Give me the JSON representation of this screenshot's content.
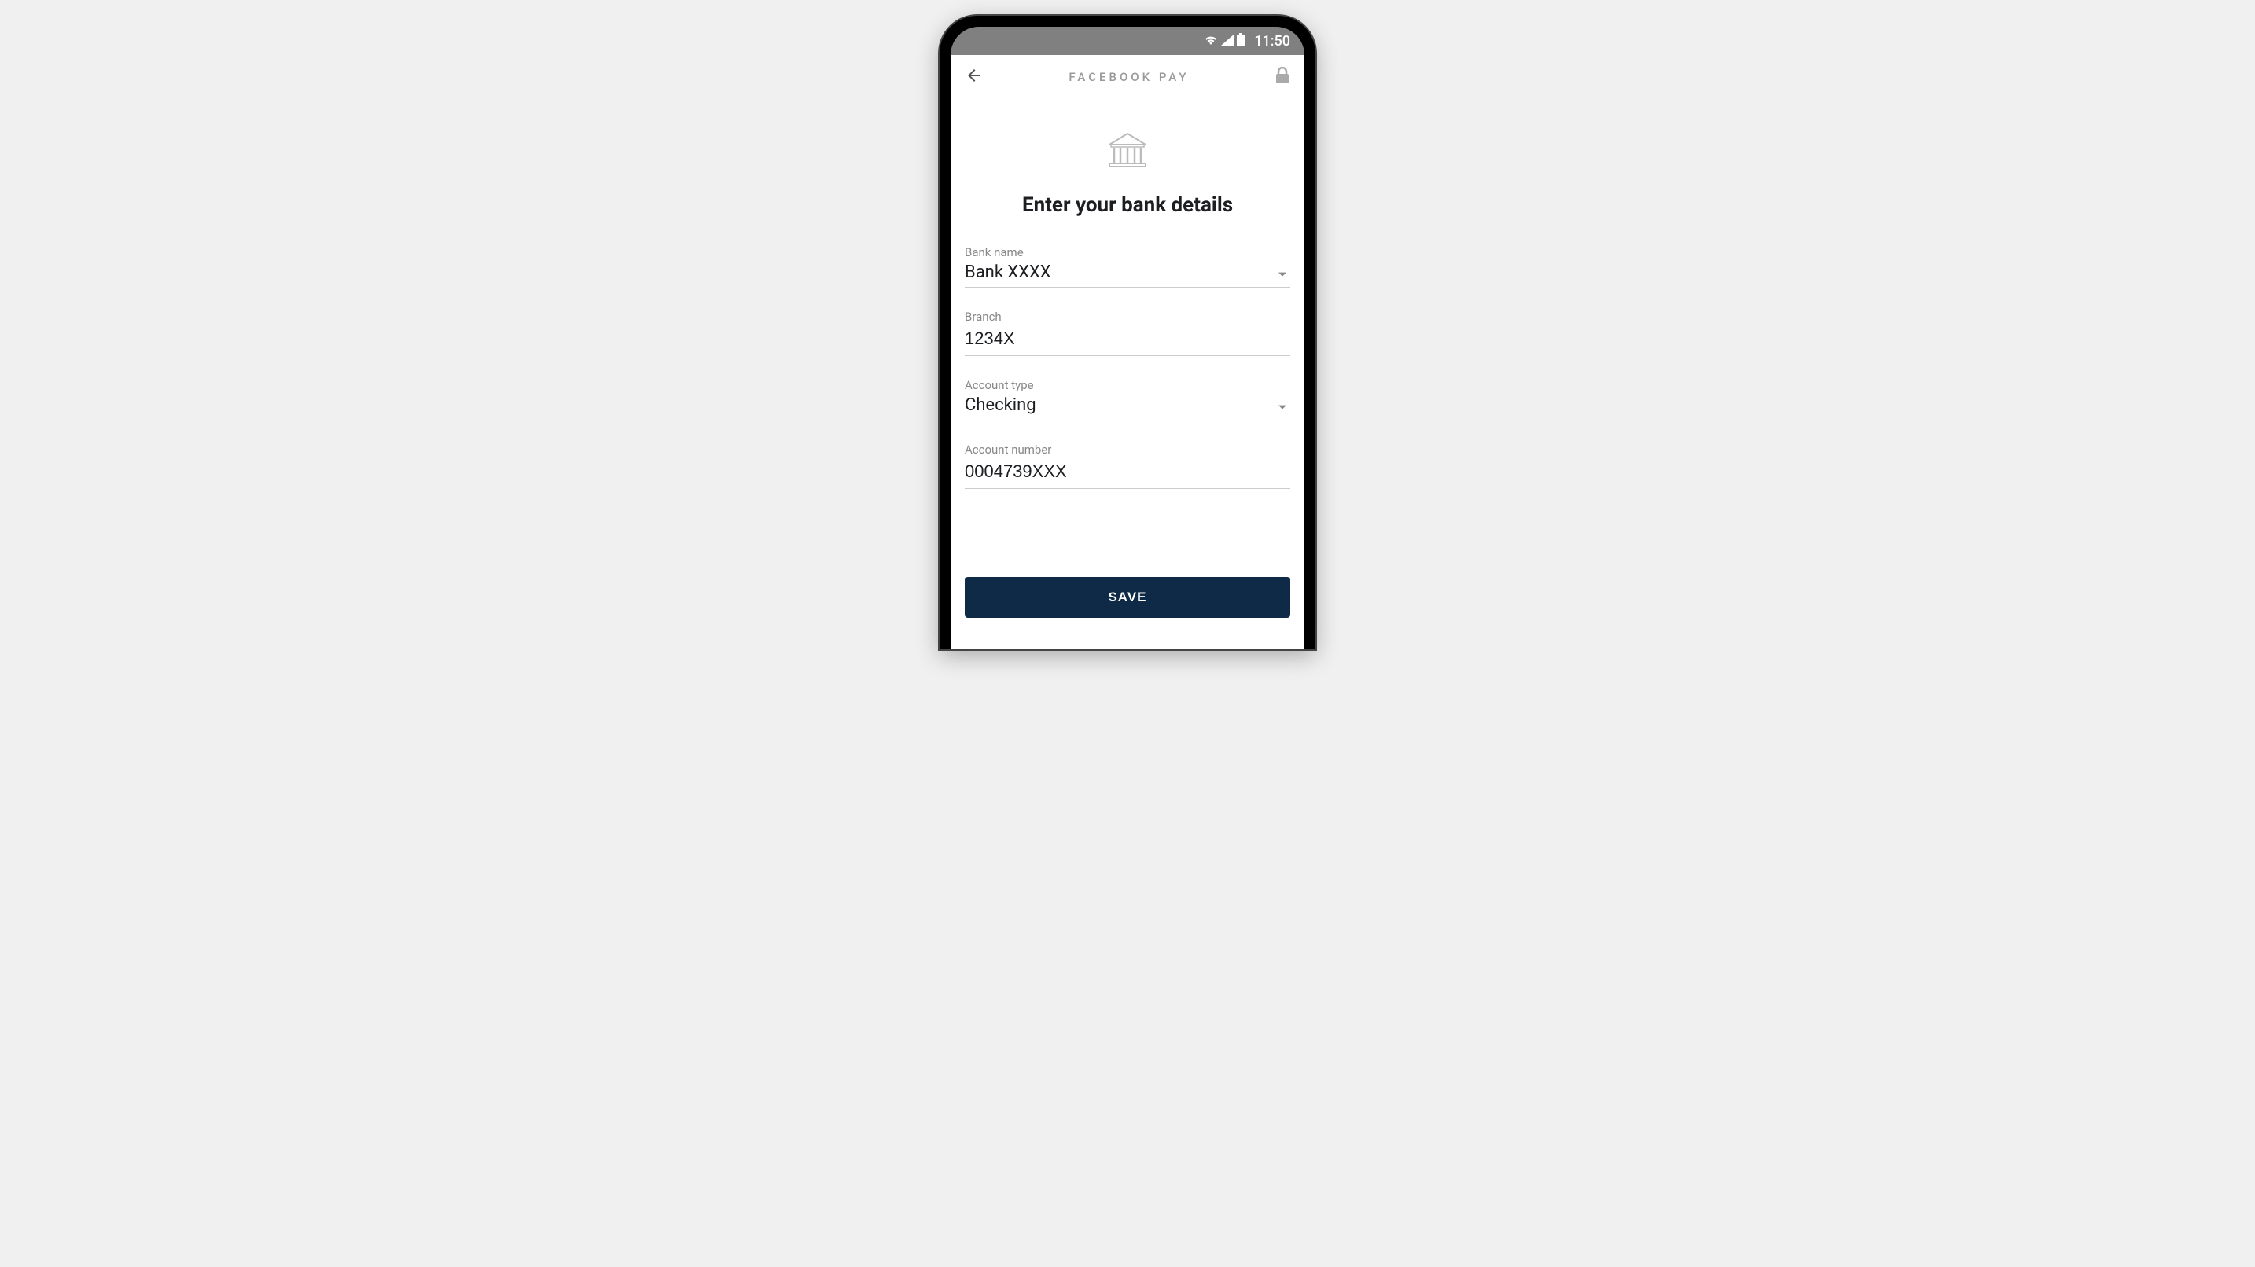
{
  "status_bar": {
    "time": "11:50"
  },
  "header": {
    "title": "FACEBOOK  PAY"
  },
  "page": {
    "title": "Enter your bank details"
  },
  "form": {
    "bank_name": {
      "label": "Bank name",
      "value": "Bank XXXX"
    },
    "branch": {
      "label": "Branch",
      "value": "1234X"
    },
    "account_type": {
      "label": "Account type",
      "value": "Checking"
    },
    "account_number": {
      "label": "Account number",
      "value": "0004739XXX"
    }
  },
  "actions": {
    "save_label": "SAVE"
  }
}
